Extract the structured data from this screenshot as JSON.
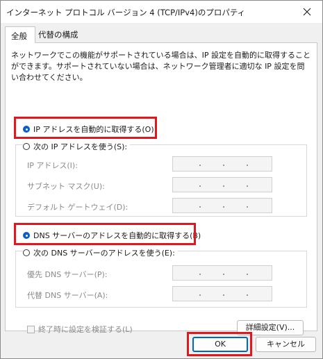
{
  "window": {
    "title": "インターネット プロトコル バージョン 4 (TCP/IPv4)のプロパティ"
  },
  "tabs": [
    {
      "label": "全般"
    },
    {
      "label": "代替の構成"
    }
  ],
  "general": {
    "description": "ネットワークでこの機能がサポートされている場合は、IP 設定を自動的に取得することができます。サポートされていない場合は、ネットワーク管理者に適切な IP 設定を問い合わせてください。",
    "ip_auto": {
      "label": "IP アドレスを自動的に取得する(O)",
      "checked": true
    },
    "ip_manual": {
      "label": "次の IP アドレスを使う(S):",
      "checked": false
    },
    "ip_fields": [
      {
        "label": "IP アドレス(I):",
        "value": ". . ."
      },
      {
        "label": "サブネット マスク(U):",
        "value": ". . ."
      },
      {
        "label": "デフォルト ゲートウェイ(D):",
        "value": ". . ."
      }
    ],
    "dns_auto": {
      "label": "DNS サーバーのアドレスを自動的に取得する(B)",
      "checked": true
    },
    "dns_manual": {
      "label": "次の DNS サーバーのアドレスを使う(E):",
      "checked": false
    },
    "dns_fields": [
      {
        "label": "優先 DNS サーバー(P):",
        "value": ". . ."
      },
      {
        "label": "代替 DNS サーバー(A):",
        "value": ". . ."
      }
    ],
    "validate_checkbox": {
      "label": "終了時に設定を検証する(L)",
      "checked": false
    },
    "advanced_button": "詳細設定(V)..."
  },
  "footer": {
    "ok": "OK",
    "cancel": "キャンセル"
  },
  "colors": {
    "highlight": "#e0181e",
    "accent": "#0a5fc6"
  }
}
